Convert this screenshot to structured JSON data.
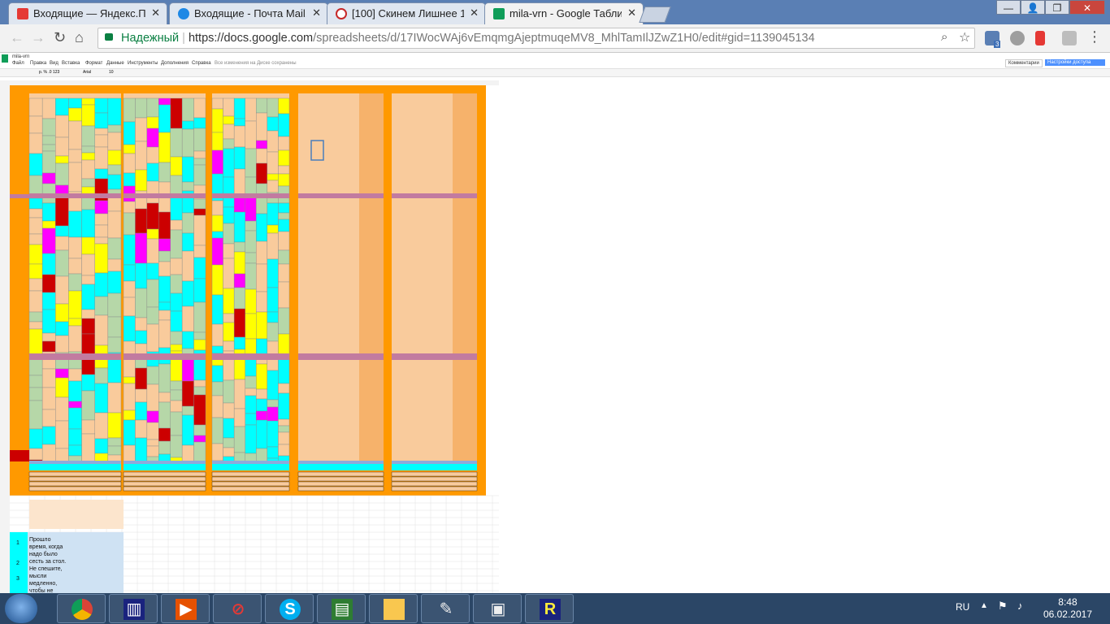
{
  "browser": {
    "tabs": [
      {
        "label": "Входящие — Яндекс.По",
        "icon": "yandex-mail-icon",
        "color": "#e53935"
      },
      {
        "label": "Входящие - Почта Mail.",
        "icon": "mailru-icon",
        "color": "#1e88e5"
      },
      {
        "label": "[100] Скинем Лишнее 1",
        "icon": "no-sign-icon",
        "color": "#c62828"
      },
      {
        "label": "mila-vrn - Google Табли",
        "icon": "sheets-icon",
        "color": "#0f9d58"
      }
    ],
    "secure_label": "Надежный",
    "url_host": "https://docs.google.com",
    "url_path": "/spreadsheets/d/17IWocWAj6vEmqmgAjeptmuqeMV8_MhlTamIlJZwZ1H0/edit#gid=1139045134",
    "mail_badge": "3"
  },
  "sheets": {
    "doc_title": "mila-vrn",
    "menu": [
      "Файл",
      "Правка",
      "Вид",
      "Вставка",
      "Формат",
      "Данные",
      "Инструменты",
      "Дополнения",
      "Справка"
    ],
    "save_status": "Все изменения на Диске сохранены",
    "comments_label": "Комментарии",
    "share_label": "Настройки доступа",
    "font_name": "Arial",
    "font_size": "10",
    "zoom_format": "р. % .0 123"
  },
  "colors": {
    "orange": "#ff9900",
    "peach": "#f9cb9c",
    "cyan": "#00ffff",
    "sage": "#b6d7a8",
    "yellow": "#ffff00",
    "red": "#cc0000",
    "magenta": "#ff00ff",
    "mauve": "#c27ba0",
    "steel": "#8eaadb"
  },
  "notes": {
    "row1_num": "1",
    "row2_num": "2",
    "row3_num": "3",
    "big_text": "Прошло время, когда надо было сесть за стол. Не спешите, мысли медленно, чтобы не перенести."
  },
  "taskbar": {
    "lang": "RU",
    "time": "8:48",
    "date": "06.02.2017",
    "apps": [
      "chrome-icon",
      "books-icon",
      "media-player-icon",
      "no-sign-icon",
      "skype-icon",
      "monitor-icon",
      "explorer-icon",
      "scanner-icon",
      "computer-icon",
      "r-app-icon"
    ]
  }
}
